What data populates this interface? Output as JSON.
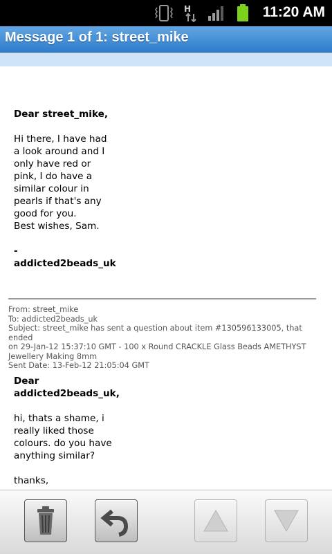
{
  "status_bar": {
    "time": "11:20 AM",
    "network_type": "H",
    "icons": [
      "vibrate-icon",
      "data-transfer-icon",
      "signal-icon",
      "battery-icon"
    ]
  },
  "header": {
    "title": "Message 1 of 1: street_mike"
  },
  "message": {
    "greeting": "Dear street_mike,",
    "body_lines": [
      "Hi there, I have had",
      "a look around and I",
      "only have red or",
      "pink, I do have a",
      "similar colour in",
      "pearls if that's any",
      "good for you.",
      "Best wishes, Sam."
    ],
    "signature_dash": "-",
    "signature": "addicted2beads_uk"
  },
  "quoted": {
    "from": "From: street_mike",
    "to": "To: addicted2beads_uk",
    "subject_line1": "Subject: street_mike has sent a question about item #130596133005, that ended",
    "subject_line2": "on 29-Jan-12 15:37:10 GMT - 100 x Round CRACKLE Glass Beads AMETHYST",
    "subject_line3": "Jewellery Making 8mm",
    "sent_date": "Sent Date: 13-Feb-12 21:05:04 GMT",
    "greeting_line1": "Dear",
    "greeting_line2": "addicted2beads_uk,",
    "body_lines": [
      "hi, thats a shame, i",
      "really liked those",
      "colours. do you have",
      "anything similar?"
    ],
    "closing": "thanks,"
  },
  "toolbar": {
    "buttons": [
      {
        "name": "delete",
        "icon": "trash-icon",
        "enabled": true
      },
      {
        "name": "reply",
        "icon": "reply-arrow-icon",
        "enabled": true
      },
      {
        "name": "previous",
        "icon": "up-arrow-icon",
        "enabled": false
      },
      {
        "name": "next",
        "icon": "down-arrow-icon",
        "enabled": false
      }
    ]
  },
  "colors": {
    "title_bar": "#3d8ad6",
    "sub_strip": "#cfe4f8",
    "battery": "#7bd11c",
    "status_bar": "#000000"
  }
}
